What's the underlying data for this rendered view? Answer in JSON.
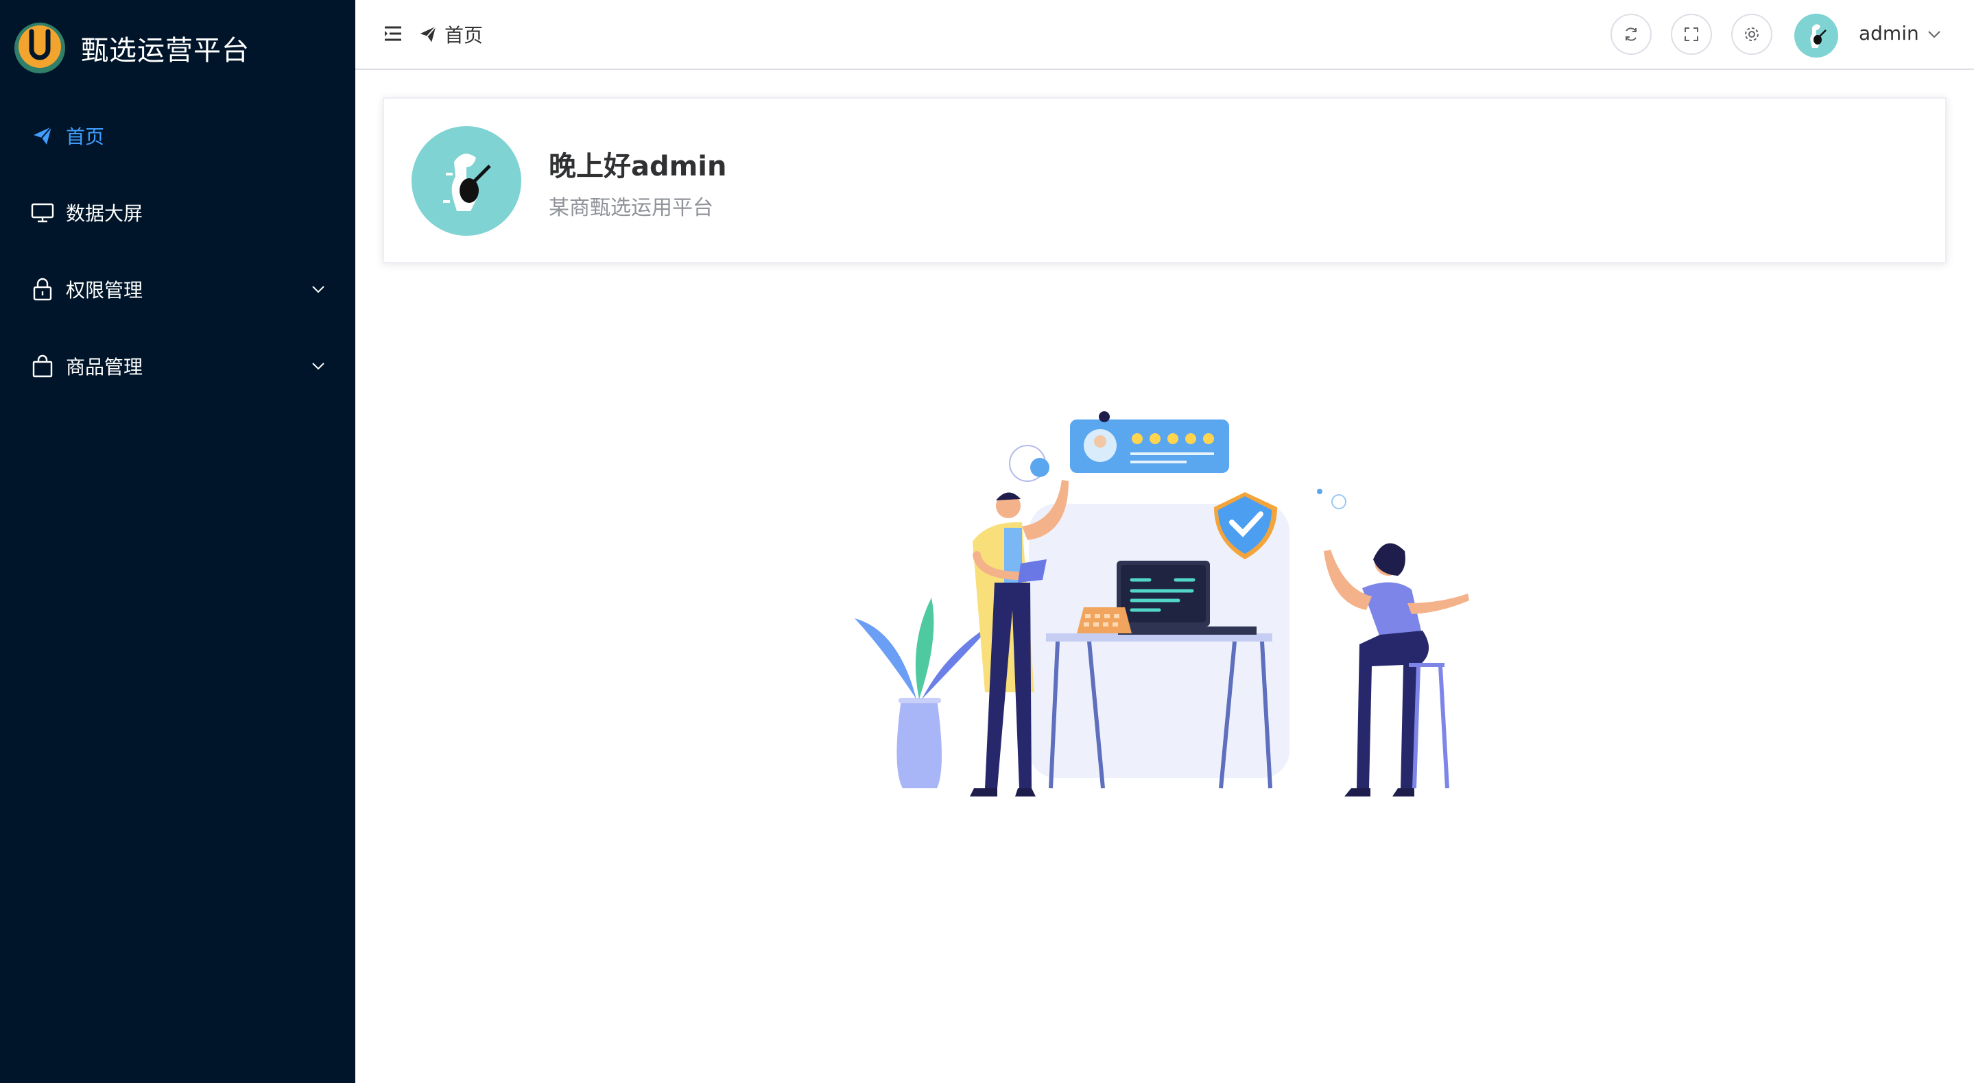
{
  "brand": {
    "title": "甄选运营平台",
    "logo_letter": "U"
  },
  "sidebar": {
    "items": [
      {
        "label": "首页",
        "icon": "paper-plane-icon",
        "active": true
      },
      {
        "label": "数据大屏",
        "icon": "monitor-icon"
      },
      {
        "label": "权限管理",
        "icon": "lock-icon",
        "expandable": true
      },
      {
        "label": "商品管理",
        "icon": "shopping-bag-icon",
        "expandable": true
      }
    ]
  },
  "header": {
    "breadcrumb": "首页",
    "tools": [
      "refresh-icon",
      "fullscreen-icon",
      "settings-icon"
    ],
    "user_name": "admin"
  },
  "welcome": {
    "greeting": "晚上好admin",
    "subtitle": "某商甄选运用平台"
  },
  "colors": {
    "sidebar_bg": "#001529",
    "accent": "#409eff",
    "avatar_bg": "#7fd3d3"
  }
}
